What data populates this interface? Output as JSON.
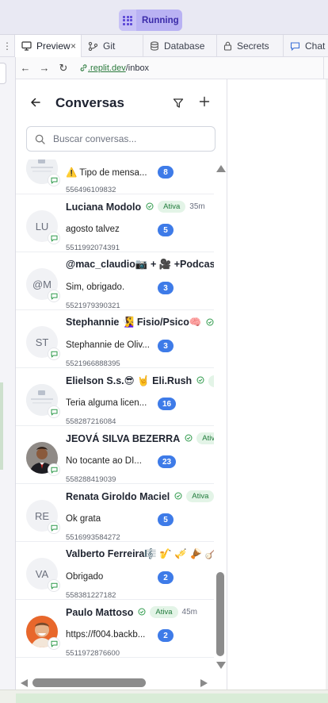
{
  "topbar": {
    "run_label": "Running"
  },
  "tabs": [
    {
      "label": "Preview",
      "icon": "monitor-icon",
      "close": "×"
    },
    {
      "label": "Git",
      "icon": "git-branch-icon"
    },
    {
      "label": "Database",
      "icon": "database-icon"
    },
    {
      "label": "Secrets",
      "icon": "lock-icon"
    },
    {
      "label": "Chat",
      "icon": "chat-bubble-icon"
    }
  ],
  "browser": {
    "url_host": ".replit.dev",
    "url_path": "/inbox"
  },
  "header": {
    "title": "Conversas"
  },
  "search": {
    "placeholder": "Buscar conversas..."
  },
  "conversations": [
    {
      "avatar": "",
      "avatar_type": "image-gray",
      "name": "",
      "message": "⚠️ Tipo de mensa...",
      "count": "8",
      "phone": "556496109832",
      "status": "",
      "ago": ""
    },
    {
      "avatar": "LU",
      "name": "Luciana Modolo",
      "verified": true,
      "status": "Ativa",
      "ago": "35m",
      "message": "agosto talvez",
      "count": "5",
      "phone": "5511992074391"
    },
    {
      "avatar": "@M",
      "name": "@mac_claudio📷 + 🎥 +Podcas",
      "message": "Sim, obrigado.",
      "count": "3",
      "phone": "5521979390321"
    },
    {
      "avatar": "ST",
      "name": "Stephannie 🧏‍♀️ Fisio/Psico🧠",
      "verified": true,
      "message": "Stephannie de Oliv...",
      "count": "3",
      "phone": "5521966888395"
    },
    {
      "avatar": "",
      "avatar_type": "image-gray",
      "name": "Elielson S.s.😎 🤘 Eli.Rush",
      "verified": true,
      "status": "A",
      "message": "Teria alguma licen...",
      "count": "16",
      "phone": "558287216084"
    },
    {
      "avatar": "",
      "avatar_type": "photo-man",
      "name": "JEOVÁ SILVA BEZERRA",
      "verified": true,
      "status": "Ativa",
      "message": "No tocante ao DI...",
      "count": "23",
      "phone": "558288419039"
    },
    {
      "avatar": "RE",
      "name": "Renata Giroldo Maciel",
      "verified": true,
      "status": "Ativa",
      "message": "Ok grata",
      "count": "5",
      "phone": "5516993584272"
    },
    {
      "avatar": "VA",
      "name": "Valberto Ferreira🎼 🎷 🎺 🪘 🪕",
      "message": "Obrigado",
      "count": "2",
      "phone": "558381227182"
    },
    {
      "avatar": "",
      "avatar_type": "photo-orange",
      "name": "Paulo Mattoso",
      "verified": true,
      "status": "Ativa",
      "ago": "45m",
      "message": "https://f004.backb...",
      "count": "2",
      "phone": "5511972876600"
    }
  ],
  "colors": {
    "accent": "#3e7be8",
    "active_badge_bg": "#e3f4e7",
    "active_badge_text": "#1f7a3a",
    "run_pill": "#b9b2f3"
  }
}
